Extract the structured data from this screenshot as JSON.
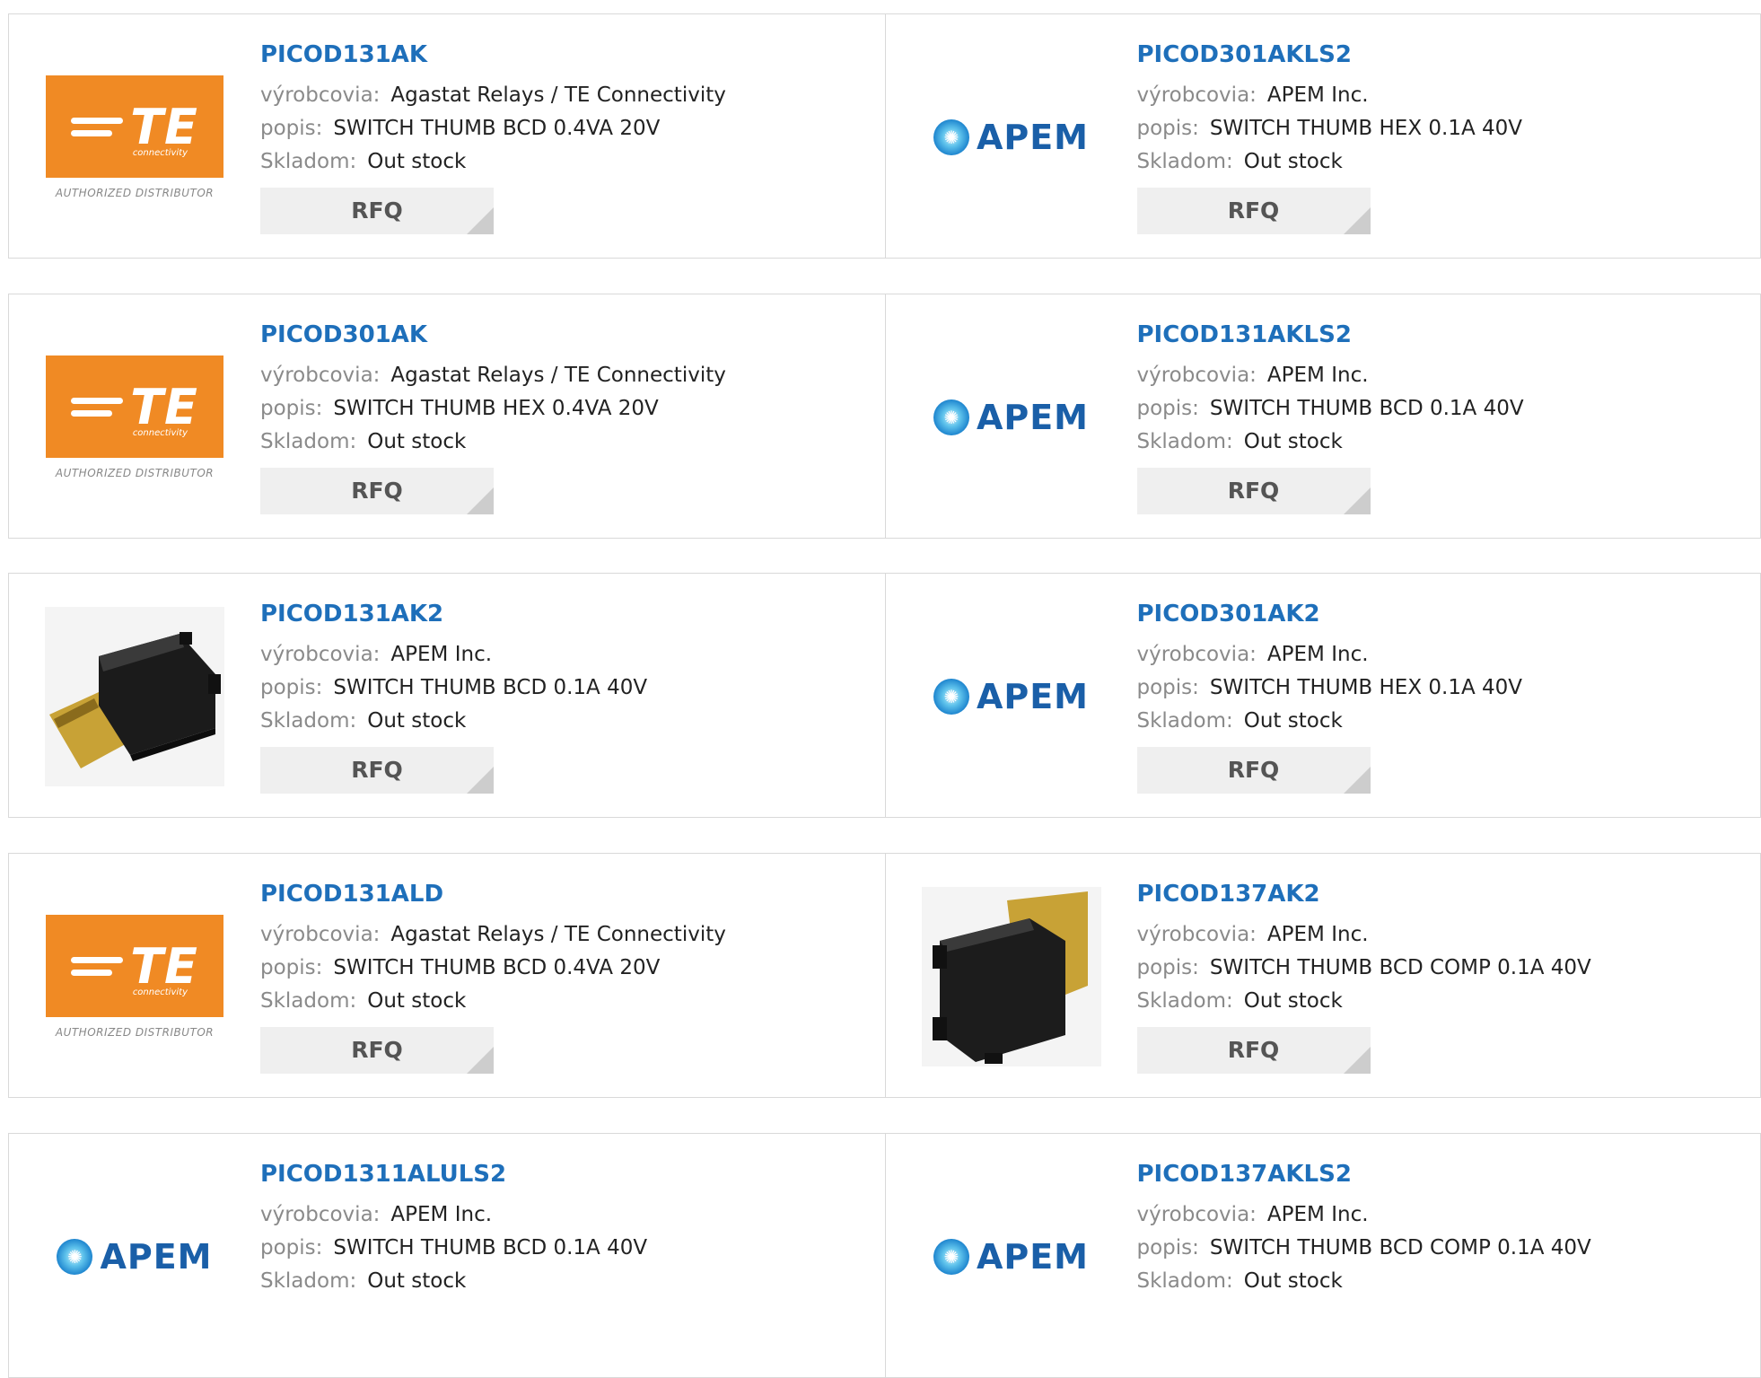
{
  "labels": {
    "manufacturer": "výrobcovia:",
    "description": "popis:",
    "stock": "Skladom:",
    "rfq": "RFQ"
  },
  "logos": {
    "te": {
      "word": "TE",
      "sub": "connectivity",
      "caption": "AUTHORIZED DISTRIBUTOR"
    },
    "apem": {
      "word": "APEM"
    }
  },
  "colors": {
    "link": "#1e6fba",
    "te_orange": "#f08a24",
    "apem_blue": "#1a5fa8"
  },
  "products": [
    {
      "part": "PICOD131AK",
      "manufacturer": "Agastat Relays / TE Connectivity",
      "description": "SWITCH THUMB BCD 0.4VA 20V",
      "stock": "Out stock",
      "image": "te-logo"
    },
    {
      "part": "PICOD301AKLS2",
      "manufacturer": "APEM Inc.",
      "description": "SWITCH THUMB HEX 0.1A 40V",
      "stock": "Out stock",
      "image": "apem-logo"
    },
    {
      "part": "PICOD301AK",
      "manufacturer": "Agastat Relays / TE Connectivity",
      "description": "SWITCH THUMB HEX 0.4VA 20V",
      "stock": "Out stock",
      "image": "te-logo"
    },
    {
      "part": "PICOD131AKLS2",
      "manufacturer": "APEM Inc.",
      "description": "SWITCH THUMB BCD 0.1A 40V",
      "stock": "Out stock",
      "image": "apem-logo"
    },
    {
      "part": "PICOD131AK2",
      "manufacturer": "APEM Inc.",
      "description": "SWITCH THUMB BCD 0.1A 40V",
      "stock": "Out stock",
      "image": "photo-switch"
    },
    {
      "part": "PICOD301AK2",
      "manufacturer": "APEM Inc.",
      "description": "SWITCH THUMB HEX 0.1A 40V",
      "stock": "Out stock",
      "image": "apem-logo"
    },
    {
      "part": "PICOD131ALD",
      "manufacturer": "Agastat Relays / TE Connectivity",
      "description": "SWITCH THUMB BCD 0.4VA 20V",
      "stock": "Out stock",
      "image": "te-logo"
    },
    {
      "part": "PICOD137AK2",
      "manufacturer": "APEM Inc.",
      "description": "SWITCH THUMB BCD COMP 0.1A 40V",
      "stock": "Out stock",
      "image": "photo-switch-vertical"
    },
    {
      "part": "PICOD1311ALULS2",
      "manufacturer": "APEM Inc.",
      "description": "SWITCH THUMB BCD 0.1A 40V",
      "stock": "Out stock",
      "image": "apem-logo"
    },
    {
      "part": "PICOD137AKLS2",
      "manufacturer": "APEM Inc.",
      "description": "SWITCH THUMB BCD COMP 0.1A 40V",
      "stock": "Out stock",
      "image": "apem-logo"
    }
  ]
}
